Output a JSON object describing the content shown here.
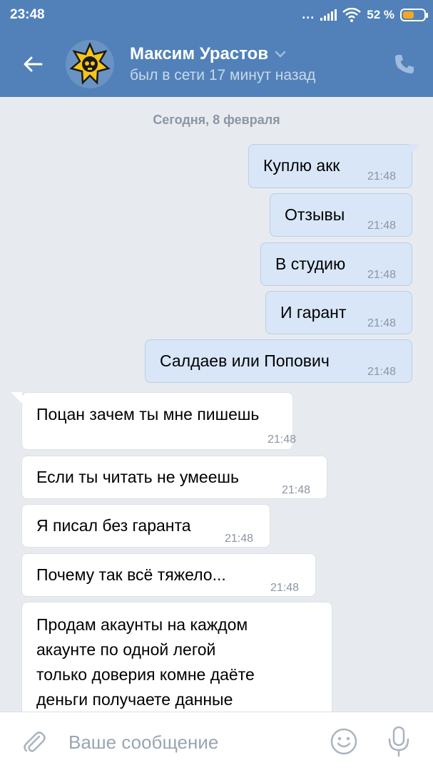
{
  "status_bar": {
    "time": "23:48",
    "dots": "...",
    "battery": "52 %",
    "battery_level": 0.52,
    "icons": [
      "signal-icon",
      "wifi-icon",
      "battery-icon"
    ]
  },
  "header": {
    "contact_name": "Максим Урастов",
    "status": "был в сети 17 минут назад",
    "icons": [
      "back-arrow-icon",
      "avatar",
      "chevron-down-icon",
      "phone-icon"
    ]
  },
  "chat": {
    "date": "Сегодня, 8 февраля",
    "messages": [
      {
        "direction": "out",
        "text": "Куплю акк",
        "time": "21:48"
      },
      {
        "direction": "out",
        "text": "Отзывы",
        "time": "21:48"
      },
      {
        "direction": "out",
        "text": "В студию",
        "time": "21:48"
      },
      {
        "direction": "out",
        "text": "И гарант",
        "time": "21:48"
      },
      {
        "direction": "out",
        "text": "Салдаев или Попович",
        "time": "21:48"
      },
      {
        "direction": "in",
        "text": "Поцан зачем ты мне пишешь",
        "time": "21:48"
      },
      {
        "direction": "in",
        "text": "Если ты читать не умеешь",
        "time": "21:48"
      },
      {
        "direction": "in",
        "text": "Я писал без гаранта",
        "time": "21:48"
      },
      {
        "direction": "in",
        "text": "Почему так всё тяжело...",
        "time": "21:48"
      },
      {
        "direction": "in",
        "lines": [
          "Продам акаунты на каждом",
          "акаунте по одной легой",
          "только доверия комне даёте",
          "деньги получаете данные"
        ]
      }
    ]
  },
  "input_bar": {
    "placeholder": "Ваше сообщение",
    "value": "",
    "icons": [
      "paperclip-icon",
      "emoji-icon",
      "microphone-icon"
    ]
  },
  "colors": {
    "header_bg": "#5181b8",
    "chat_bg": "#e7ebf0",
    "outgoing_bubble": "#d8e6f8",
    "incoming_bubble": "#ffffff",
    "battery_fill": "#f5a623"
  }
}
